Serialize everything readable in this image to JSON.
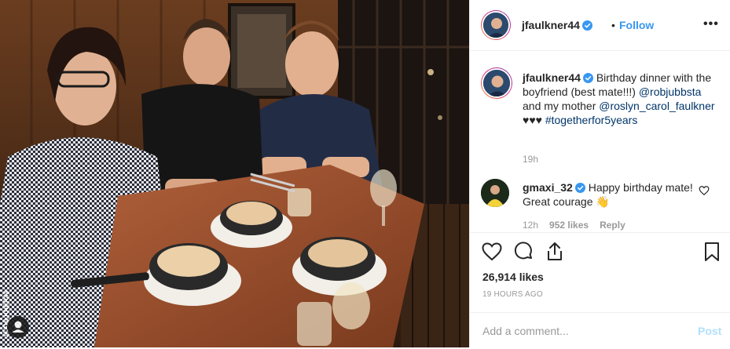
{
  "photo": {
    "watermark": "JFAULKNER44",
    "tag_icon": "user-tag-icon"
  },
  "header": {
    "username": "jfaulkner44",
    "verified_icon": "verified-badge-icon",
    "separator": "•",
    "follow_label": "Follow",
    "more_label": "•••"
  },
  "caption": {
    "username": "jfaulkner44",
    "text_1": " Birthday dinner with the boyfriend (best mate!!!) ",
    "mention_1": "@robjubbsta",
    "text_2": " and my mother ",
    "mention_2": "@roslyn_carol_faulkner",
    "text_3": " ♥♥♥ ",
    "hashtag": "#togetherfor5years",
    "time": "19h"
  },
  "comment": {
    "username": "gmaxi_32",
    "text": " Happy birthday mate! Great courage 👋",
    "time": "12h",
    "likes": "952 likes",
    "reply_label": "Reply"
  },
  "actions": {
    "like_icon": "heart-icon",
    "comment_icon": "comment-icon",
    "share_icon": "share-icon",
    "save_icon": "bookmark-icon",
    "likes_count": "26,914 likes",
    "posted_ago": "19 HOURS AGO"
  },
  "add_comment": {
    "placeholder": "Add a comment...",
    "post_label": "Post"
  },
  "colors": {
    "link": "#003569",
    "follow": "#3897f0",
    "verified": "#3897f0",
    "post_disabled": "#b2dffc",
    "muted": "#999999"
  }
}
